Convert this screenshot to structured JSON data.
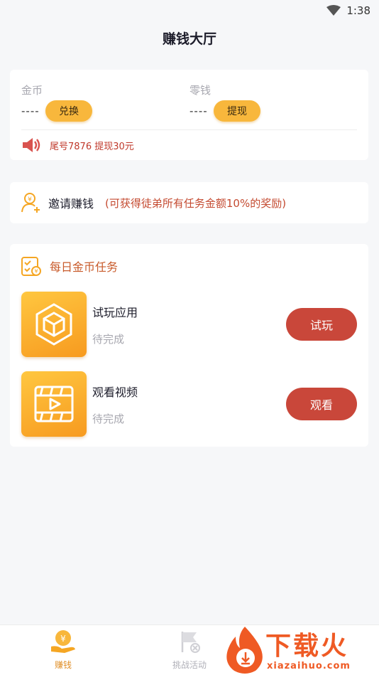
{
  "status": {
    "time": "1:38"
  },
  "header": {
    "title": "赚钱大厅"
  },
  "wallet": {
    "coins": {
      "label": "金币",
      "value": "----",
      "button": "兑换"
    },
    "cash": {
      "label": "零钱",
      "value": "----",
      "button": "提现"
    },
    "notice": "尾号7876 提现30元"
  },
  "invite": {
    "title": "邀请赚钱",
    "hint": "(可获得徒弟所有任务金额10%的奖励)"
  },
  "tasks": {
    "title": "每日金币任务",
    "items": [
      {
        "name": "试玩应用",
        "status": "待完成",
        "button": "试玩"
      },
      {
        "name": "观看视频",
        "status": "待完成",
        "button": "观看"
      }
    ]
  },
  "tabbar": {
    "items": [
      {
        "label": "赚钱",
        "active": true
      },
      {
        "label": "挑战活动",
        "active": false
      }
    ]
  },
  "watermark": {
    "text": "下载火",
    "url": "xiazaihuo.com"
  },
  "colors": {
    "accent": "#f8b73c",
    "action": "#c9473a",
    "notice": "#c0392b"
  }
}
